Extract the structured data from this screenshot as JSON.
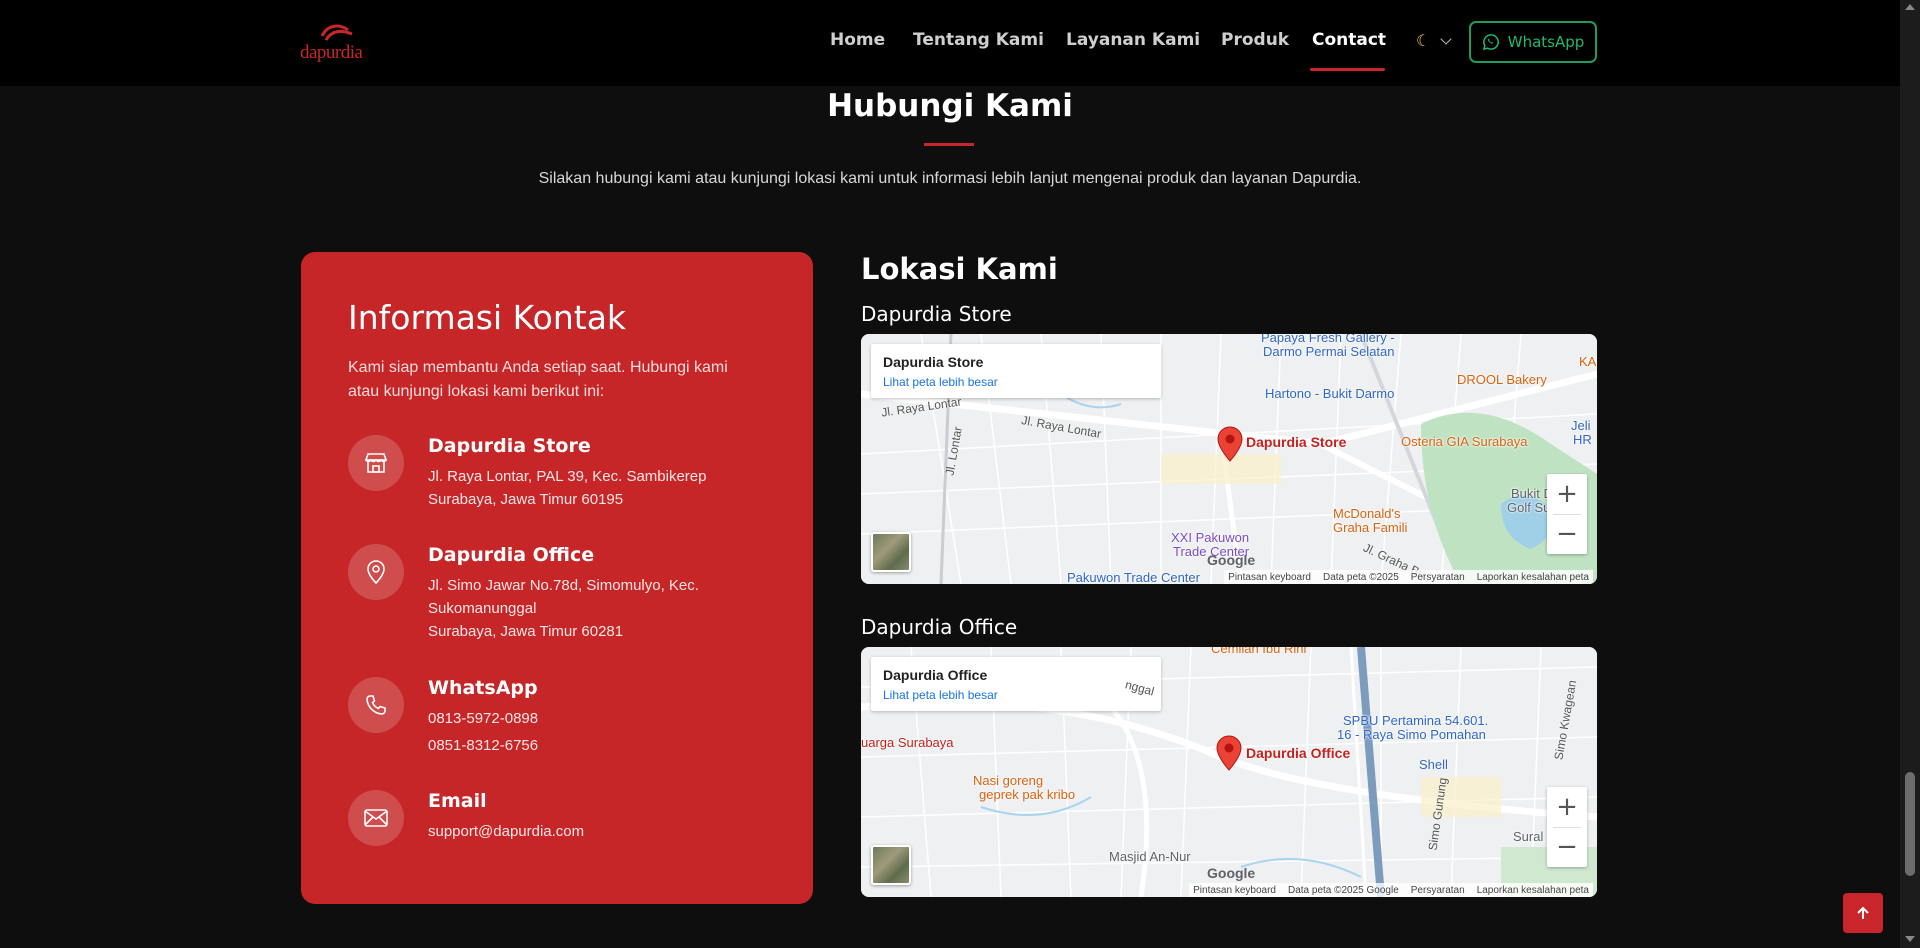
{
  "nav": {
    "logo_text": "dapurdia",
    "links": [
      {
        "label": "Home",
        "active": false
      },
      {
        "label": "Tentang Kami",
        "active": false
      },
      {
        "label": "Layanan Kami",
        "active": false
      },
      {
        "label": "Produk",
        "active": false
      },
      {
        "label": "Contact",
        "active": true
      }
    ],
    "theme_icon": "moon-icon",
    "whatsapp_label": "WhatsApp"
  },
  "header": {
    "title": "Hubungi Kami",
    "subtitle": "Silakan hubungi kami atau kunjungi lokasi kami untuk informasi lebih lanjut mengenai produk dan layanan Dapurdia."
  },
  "contact": {
    "title": "Informasi Kontak",
    "description": "Kami siap membantu Anda setiap saat. Hubungi kami atau kunjungi lokasi kami berikut ini:",
    "items": [
      {
        "icon": "store-icon",
        "title": "Dapurdia Store",
        "lines": [
          "Jl. Raya Lontar, PAL 39, Kec. Sambikerep",
          "Surabaya, Jawa Timur 60195"
        ]
      },
      {
        "icon": "location-pin-icon",
        "title": "Dapurdia Office",
        "lines": [
          "Jl. Simo Jawar No.78d, Simomulyo, Kec.",
          "Sukomanunggal",
          "Surabaya, Jawa Timur 60281"
        ]
      },
      {
        "icon": "phone-icon",
        "title": "WhatsApp",
        "lines": [
          "0813-5972-0898",
          "0851-8312-6756"
        ]
      },
      {
        "icon": "envelope-icon",
        "title": "Email",
        "lines": [
          "support@dapurdia.com"
        ]
      }
    ]
  },
  "locations": {
    "title": "Lokasi Kami",
    "maps": [
      {
        "label": "Dapurdia Store",
        "box_title": "Dapurdia Store",
        "box_link": "Lihat peta lebih besar",
        "pin_label": "Dapurdia Store",
        "pois": [
          {
            "text": "Papaya Fresh Gallery -",
            "cls": "blue"
          },
          {
            "text": "Darmo Permai Selatan",
            "cls": "blue"
          },
          {
            "text": "Hartono - Bukit Darmo",
            "cls": "blue"
          },
          {
            "text": "DROOL Bakery",
            "cls": "orange"
          },
          {
            "text": "Osteria GIA Surabaya",
            "cls": "orange"
          },
          {
            "text": "McDonald's",
            "cls": "orange"
          },
          {
            "text": "Graha Famili",
            "cls": "orange"
          },
          {
            "text": "XXI Pakuwon",
            "cls": "purple"
          },
          {
            "text": "Trade Center",
            "cls": "purple"
          },
          {
            "text": "Pakuwon Trade Center",
            "cls": "blue"
          },
          {
            "text": "Bukit Darm",
            "cls": "gray"
          },
          {
            "text": "Golf Suraba",
            "cls": "gray"
          },
          {
            "text": "Jeli",
            "cls": "blue"
          },
          {
            "text": "HR",
            "cls": "blue"
          },
          {
            "text": "KA",
            "cls": "orange"
          }
        ],
        "streets": [
          "Jl. Raya Lontar",
          "Jl. Raya Lontar",
          "Jl. Lontar",
          "Jl. Graha Bu"
        ],
        "attribution": [
          "Pintasan keyboard",
          "Data peta ©2025",
          "Persyaratan",
          "Laporkan kesalahan peta"
        ],
        "google": "Google"
      },
      {
        "label": "Dapurdia Office",
        "box_title": "Dapurdia Office",
        "box_link": "Lihat peta lebih besar",
        "pin_label": "Dapurdia Office",
        "pois": [
          {
            "text": "Cemilan Ibu Rini",
            "cls": "orange"
          },
          {
            "text": "SPBU Pertamina 54.601.",
            "cls": "blue"
          },
          {
            "text": "16 - Raya Simo Pomahan",
            "cls": "blue"
          },
          {
            "text": "Shell",
            "cls": "blue"
          },
          {
            "text": "uarga Surabaya",
            "cls": "red"
          },
          {
            "text": "Nasi goreng",
            "cls": "orange"
          },
          {
            "text": "geprek pak kribo",
            "cls": "orange"
          },
          {
            "text": "Masjid An-Nur",
            "cls": "gray"
          },
          {
            "text": "Sural",
            "cls": "gray"
          }
        ],
        "streets": [
          "nggal",
          "Simo Kwagean",
          "Simo Gunung"
        ],
        "attribution": [
          "Pintasan keyboard",
          "Data peta ©2025 Google",
          "Persyaratan",
          "Laporkan kesalahan peta"
        ],
        "google": "Google"
      }
    ]
  },
  "colors": {
    "brand_red": "#c62628",
    "whatsapp_green": "#22b868"
  }
}
